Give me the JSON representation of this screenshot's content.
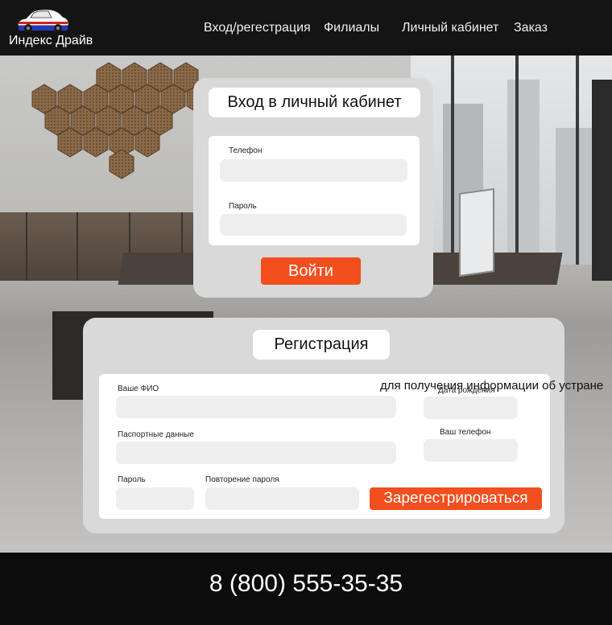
{
  "header": {
    "logo_text": "Индекс Драйв",
    "nav": [
      "Вход/регестрация",
      "Филиалы",
      "Личный кабинет",
      "Заказ"
    ]
  },
  "login": {
    "title": "Вход в личный кабинет",
    "phone_label": "Телефон",
    "phone_value": "",
    "password_label": "Пароль",
    "password_value": "",
    "submit_label": "Войти"
  },
  "register": {
    "title": "Регистрация",
    "fio_label": "Ваше ФИО",
    "passport_label": "Паспортные данные",
    "password_label": "Пароль",
    "repeat_password_label": "Повторение пароля",
    "birth_label": "Дата рождения",
    "phone_label": "Ваш телефон",
    "overflow_text": "для получения информации об устране",
    "submit_label": "Зарегестрироваться"
  },
  "footer": {
    "phone": "8 (800) 555-35-35"
  },
  "colors": {
    "accent": "#f24e1e",
    "header_bg": "#141414",
    "card_bg": "#d9d9d9",
    "field_bg": "#eeeeee"
  },
  "icons": [
    "car-logo-icon"
  ]
}
